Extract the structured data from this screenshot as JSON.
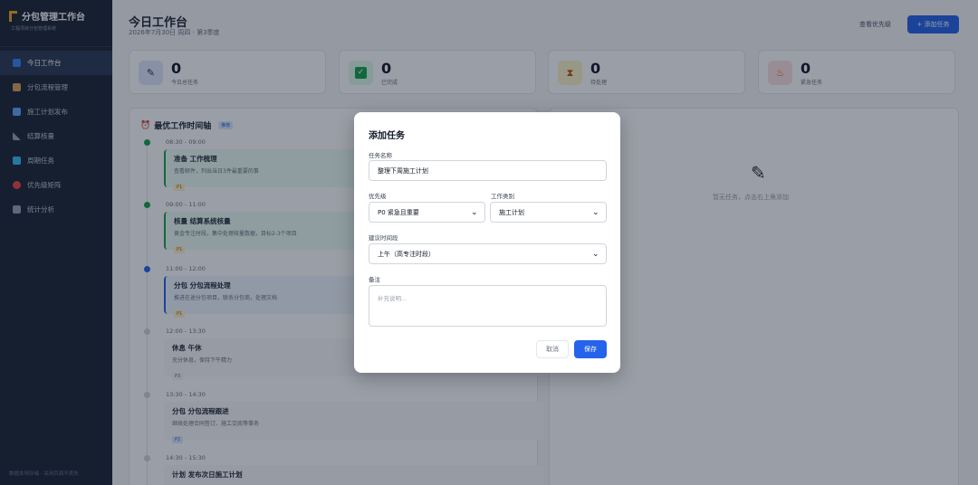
{
  "sidebar": {
    "title": "分包管理工作台",
    "subtitle": "工程项目分包管理系统",
    "items": [
      {
        "label": "今日工作台",
        "icon": "chart-icon",
        "color": "#3b82f6"
      },
      {
        "label": "分包流程管理",
        "icon": "clipboard-icon",
        "color": "#d6a45a"
      },
      {
        "label": "施工计划发布",
        "icon": "calendar-icon",
        "color": "#60a5fa"
      },
      {
        "label": "结算核量",
        "icon": "ruler-icon",
        "color": "#9ca3af"
      },
      {
        "label": "周期任务",
        "icon": "repeat-icon",
        "color": "#38bdf8"
      },
      {
        "label": "优先级矩阵",
        "icon": "target-icon",
        "color": "#ef4444"
      },
      {
        "label": "统计分析",
        "icon": "trend-icon",
        "color": "#94a3b8"
      }
    ],
    "footer": "数据本地存储 · 关闭页面不丢失"
  },
  "header": {
    "title": "今日工作台",
    "date": "2026年7月30日 周四 · 第3季度",
    "view_priority": "查看优先级",
    "add_task": "+ 添加任务"
  },
  "stats": [
    {
      "value": "0",
      "label": "今日总任务",
      "icon": "memo-icon",
      "bg": "#e0e7ff"
    },
    {
      "value": "0",
      "label": "已完成",
      "icon": "check-icon",
      "bg": "#dcfce7"
    },
    {
      "value": "0",
      "label": "待处理",
      "icon": "hourglass-icon",
      "bg": "#fef3c7"
    },
    {
      "value": "0",
      "label": "紧急任务",
      "icon": "fire-icon",
      "bg": "#fee2e2"
    }
  ],
  "timeline": {
    "title": "最优工作时间轴",
    "tag": "推荐",
    "entries": [
      {
        "time": "08:30 - 09:00",
        "title": "准备 工作梳理",
        "desc": "查看邮件，列出当日3件最重要的事",
        "priority": "P1",
        "dot": "#16a34a",
        "bg": "#ecfdf5",
        "border": "#16a34a"
      },
      {
        "time": "09:00 - 11:00",
        "title": "核量 结算系统核量",
        "desc": "黄金专注时段，集中处理核量数据，目标2-3个项目",
        "priority": "P1",
        "dot": "#16a34a",
        "bg": "#ecfdf5",
        "border": "#16a34a"
      },
      {
        "time": "11:00 - 12:00",
        "title": "分包 分包流程处理",
        "desc": "推进在途分包项目，联系分包商，处理文档",
        "priority": "P1",
        "dot": "#2563eb",
        "bg": "#eff6ff",
        "border": "#2563eb"
      },
      {
        "time": "12:00 - 13:30",
        "title": "休息 午休",
        "desc": "充分休息，保持下午精力",
        "priority": "P3",
        "dot": "#d1d5db",
        "bg": "#f9fafb",
        "border": "#e5e7eb"
      },
      {
        "time": "13:30 - 14:30",
        "title": "分包 分包流程跟进",
        "desc": "继续处理合同签订、施工交底等事务",
        "priority": "P2",
        "dot": "#d1d5db",
        "bg": "#f9fafb",
        "border": "#e5e7eb"
      },
      {
        "time": "14:30 - 15:30",
        "title": "计划 发布次日施工计划",
        "desc": "",
        "priority": "",
        "dot": "#d1d5db",
        "bg": "#f9fafb",
        "border": "#e5e7eb"
      }
    ]
  },
  "tasks_panel": {
    "empty": "暂无任务，点击右上角添加"
  },
  "modal": {
    "title": "添加任务",
    "name_label": "任务名称",
    "name_value": "整理下周施工计划",
    "priority_label": "优先级",
    "priority_value": "P0 紧急且重要",
    "category_label": "工作类别",
    "category_value": "施工计划",
    "time_label": "建议时间段",
    "time_value": "上午（高专注时段）",
    "note_label": "备注",
    "note_placeholder": "补充说明...",
    "cancel": "取消",
    "save": "保存"
  }
}
